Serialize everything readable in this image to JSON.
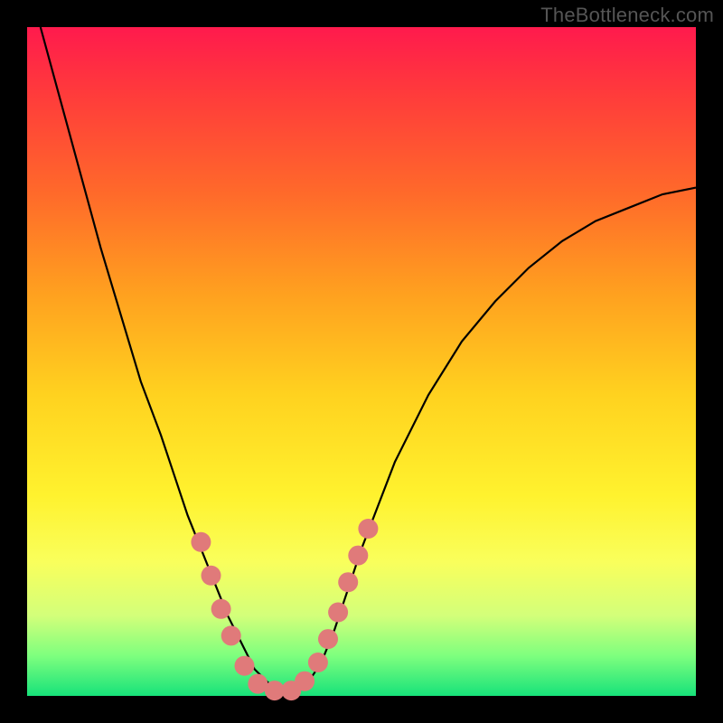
{
  "attribution": "TheBottleneck.com",
  "chart_data": {
    "type": "line",
    "title": "",
    "xlabel": "",
    "ylabel": "",
    "xlim": [
      0,
      100
    ],
    "ylim": [
      0,
      100
    ],
    "series": [
      {
        "name": "curve",
        "x": [
          2,
          5,
          8,
          11,
          14,
          17,
          20,
          22,
          24,
          26,
          28,
          30,
          32,
          34,
          36,
          38,
          40,
          42,
          44,
          46,
          48,
          50,
          55,
          60,
          65,
          70,
          75,
          80,
          85,
          90,
          95,
          100
        ],
        "values": [
          100,
          89,
          78,
          67,
          57,
          47,
          39,
          33,
          27,
          22,
          17,
          12,
          8,
          4,
          2,
          1,
          1,
          2,
          5,
          10,
          16,
          22,
          35,
          45,
          53,
          59,
          64,
          68,
          71,
          73,
          75,
          76
        ]
      }
    ],
    "markers": {
      "name": "highlight-beads",
      "color": "#e07a7a",
      "radius": 11,
      "points": [
        {
          "x": 26,
          "y": 23
        },
        {
          "x": 27.5,
          "y": 18
        },
        {
          "x": 29,
          "y": 13
        },
        {
          "x": 30.5,
          "y": 9
        },
        {
          "x": 32.5,
          "y": 4.5
        },
        {
          "x": 34.5,
          "y": 1.8
        },
        {
          "x": 37,
          "y": 0.8
        },
        {
          "x": 39.5,
          "y": 0.8
        },
        {
          "x": 41.5,
          "y": 2.2
        },
        {
          "x": 43.5,
          "y": 5
        },
        {
          "x": 45,
          "y": 8.5
        },
        {
          "x": 46.5,
          "y": 12.5
        },
        {
          "x": 48,
          "y": 17
        },
        {
          "x": 49.5,
          "y": 21
        },
        {
          "x": 51,
          "y": 25
        }
      ]
    }
  }
}
